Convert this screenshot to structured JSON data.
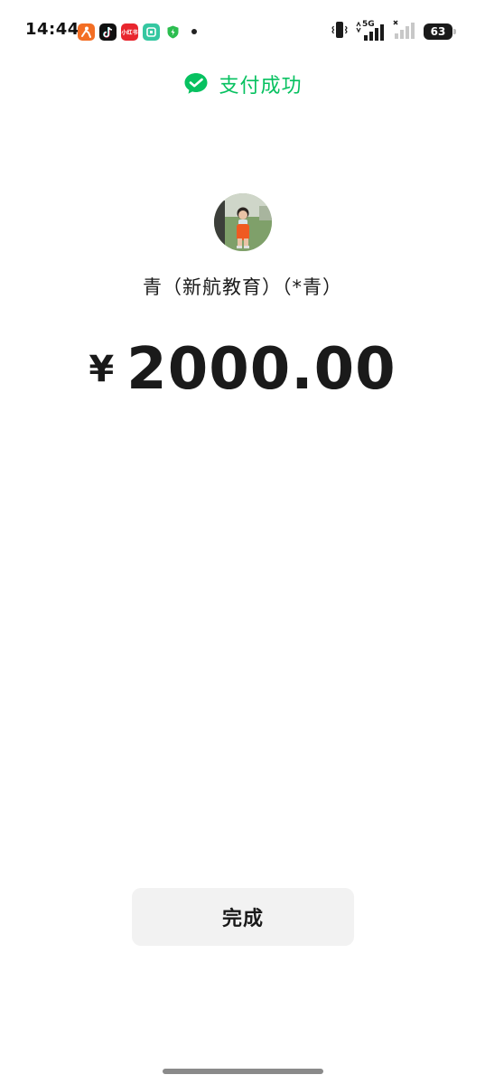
{
  "status_bar": {
    "time": "14:44",
    "apps": [
      {
        "name": "dingtalk-style-app-icon",
        "label": "",
        "color": "#f36e24"
      },
      {
        "name": "tiktok-icon",
        "label": "",
        "color": "#111111"
      },
      {
        "name": "xiaohongshu-icon",
        "label": "小红书",
        "color": "#e8262e"
      },
      {
        "name": "mi-home-icon",
        "label": "",
        "color": "#35c7a1"
      },
      {
        "name": "security-shield-icon",
        "label": "",
        "color": "#2bbd4f"
      }
    ],
    "network": "5G",
    "battery": "63"
  },
  "header": {
    "title": "支付成功",
    "icon": "wechat-pay-check-icon",
    "accent_color": "#07c160"
  },
  "payee": {
    "name": "青（新航教育）（*青）",
    "avatar": "child-photo-avatar"
  },
  "payment": {
    "currency_symbol": "¥",
    "amount": "2000.00"
  },
  "actions": {
    "done_label": "完成"
  }
}
